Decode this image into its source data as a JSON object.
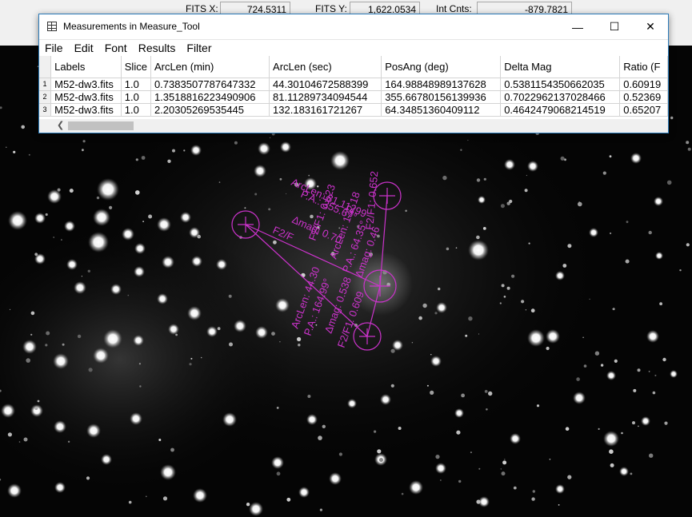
{
  "status": {
    "fits_x_label": "FITS X:",
    "fits_x_value": "724.5311",
    "fits_y_label": "FITS Y:",
    "fits_y_value": "1,622.0534",
    "int_cnts_label": "Int Cnts:",
    "int_cnts_value": "-879.7821"
  },
  "window": {
    "title": "Measurements in Measure_Tool",
    "minimize_glyph": "—",
    "maximize_glyph": "☐",
    "close_glyph": "✕",
    "menu": [
      "File",
      "Edit",
      "Font",
      "Results",
      "Filter"
    ]
  },
  "table": {
    "headers": [
      "Labels",
      "Slice",
      "ArcLen (min)",
      "ArcLen (sec)",
      "PosAng (deg)",
      "Delta Mag",
      "Ratio (F"
    ],
    "rows": [
      {
        "num": "1",
        "cells": [
          "M52-dw3.fits",
          "1.0",
          "0.7383507787647332",
          "44.30104672588399",
          "164.98848989137628",
          "0.5381154350662035",
          "0.60919"
        ]
      },
      {
        "num": "2",
        "cells": [
          "M52-dw3.fits",
          "1.0",
          "1.3518816223490906",
          "81.11289734094544",
          "355.66780156139936",
          "0.7022962137028466",
          "0.52369"
        ]
      },
      {
        "num": "3",
        "cells": [
          "M52-dw3.fits",
          "1.0",
          "2.20305269535445",
          "132.183161721267",
          "64.34851360409112",
          "0.4642479068214519",
          "0.65207"
        ]
      }
    ]
  },
  "overlay": {
    "color": "#cc33cc",
    "labels": {
      "arclen_top": "ArcLen: 81.11299",
      "pa_top": "P.A.: 355.67°",
      "dmag_top": "Δmag: 0.70",
      "ratio_top": "F2/F1: 0.523",
      "arclen_left": "ArcLen: 44.30",
      "pa_left": "P.A.: 164.99°",
      "dmag_left": "Δmag: 0.538",
      "ratio_left": "F2/F1: 0.609",
      "arclen_main": "ArcLen: 132.18",
      "pa_main": "P.A.: 64.35°",
      "dmag_main": "Δmag: 0.46",
      "ratio_main": "F2/F1: 0.652",
      "f2f_left": "F2/F"
    }
  }
}
